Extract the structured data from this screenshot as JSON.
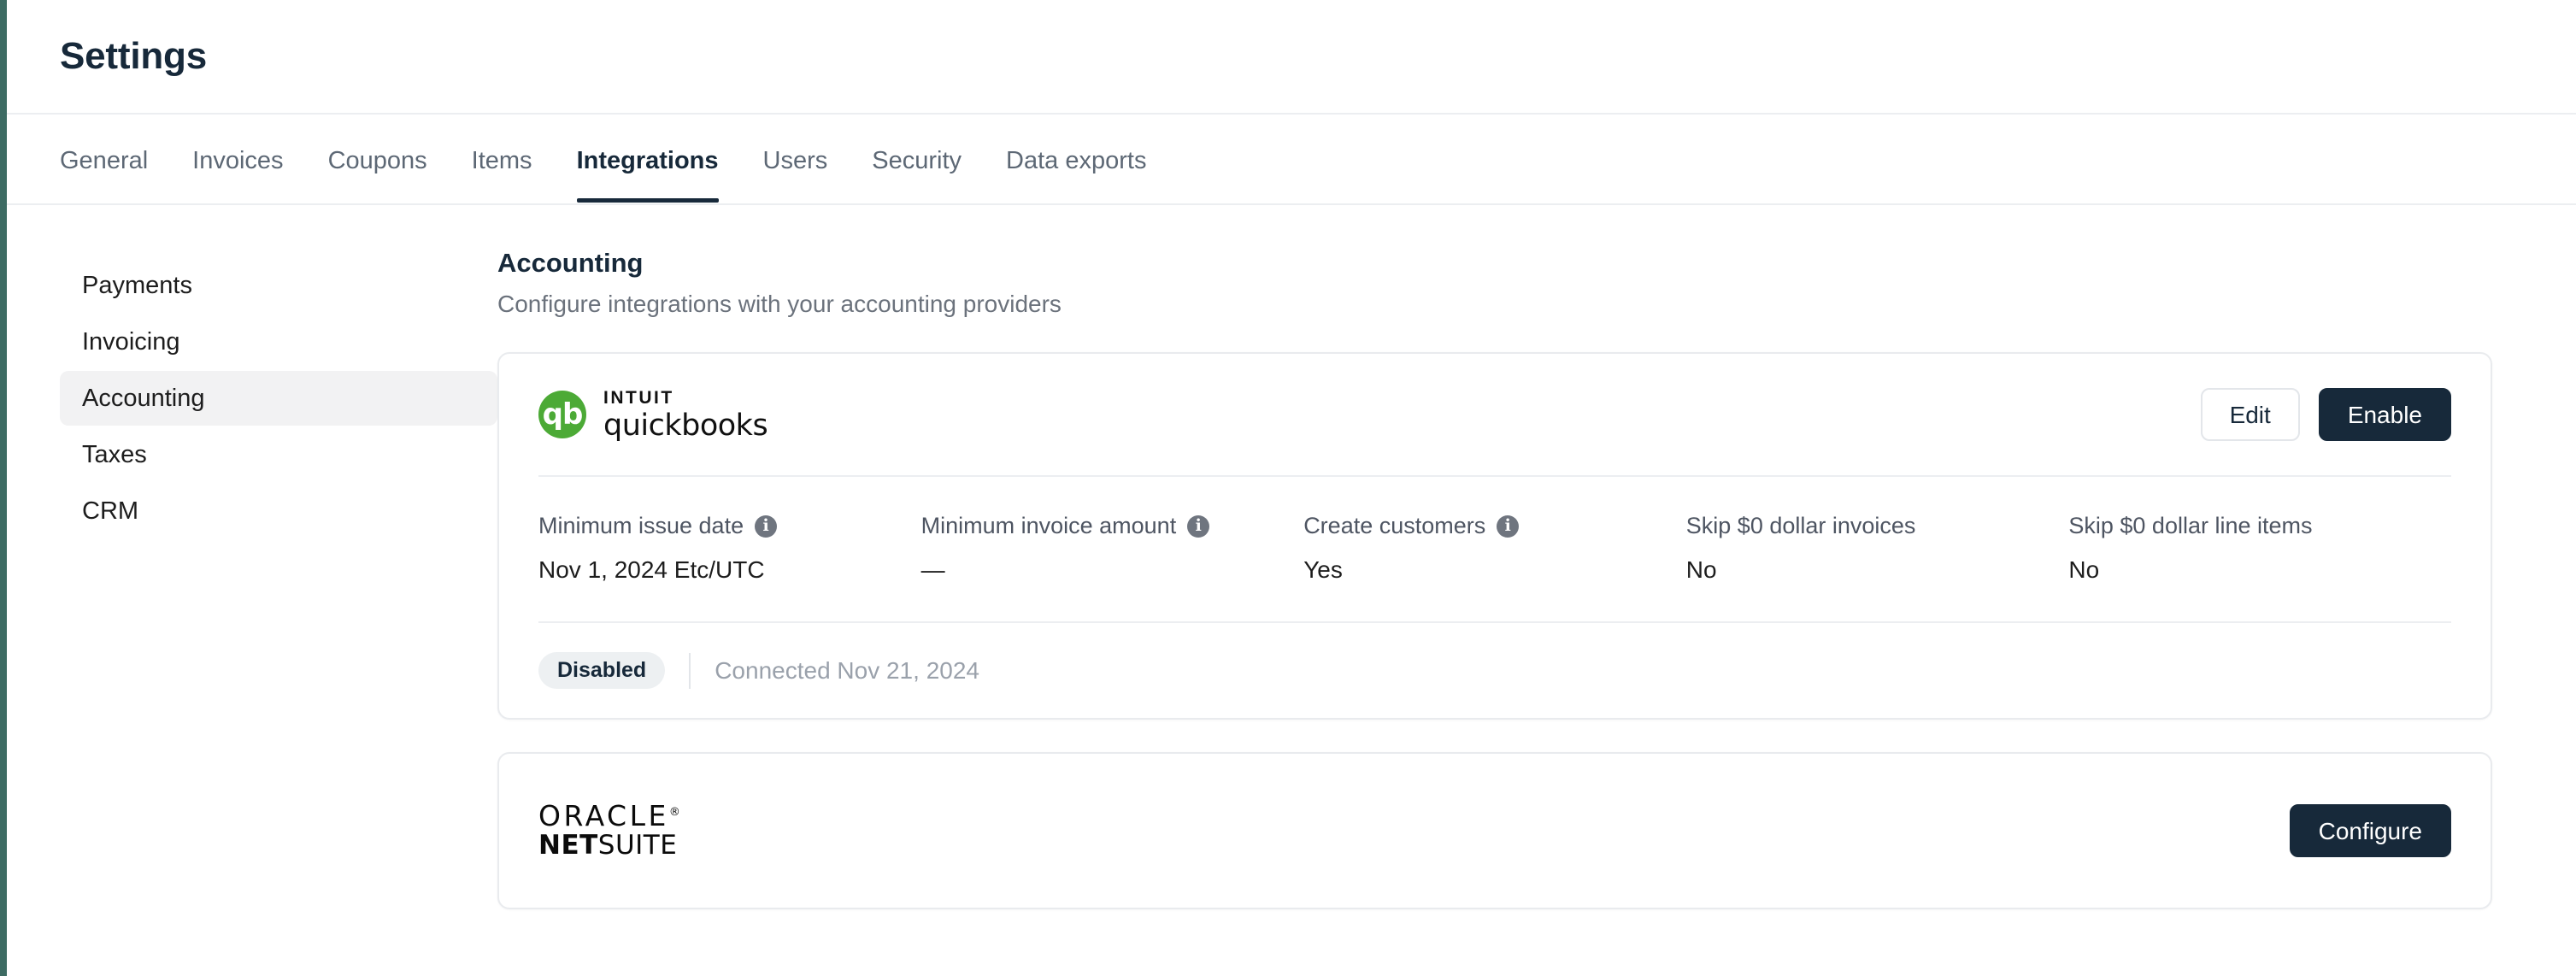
{
  "app": {
    "title": "Settings",
    "accent_stripe_color": "#3d6b63",
    "primary_color": "#17293a"
  },
  "tabs": [
    {
      "label": "General",
      "active": false
    },
    {
      "label": "Invoices",
      "active": false
    },
    {
      "label": "Coupons",
      "active": false
    },
    {
      "label": "Items",
      "active": false
    },
    {
      "label": "Integrations",
      "active": true
    },
    {
      "label": "Users",
      "active": false
    },
    {
      "label": "Security",
      "active": false
    },
    {
      "label": "Data exports",
      "active": false
    }
  ],
  "sidebar": {
    "items": [
      {
        "label": "Payments",
        "active": false
      },
      {
        "label": "Invoicing",
        "active": false
      },
      {
        "label": "Accounting",
        "active": true
      },
      {
        "label": "Taxes",
        "active": false
      },
      {
        "label": "CRM",
        "active": false
      }
    ]
  },
  "section": {
    "title": "Accounting",
    "subtitle": "Configure integrations with your accounting providers"
  },
  "quickbooks": {
    "logo": {
      "mark_text": "qb",
      "mark_color": "#4caa36",
      "brand_small": "INTUIT",
      "brand_main": "quickbooks"
    },
    "buttons": {
      "edit": "Edit",
      "enable": "Enable"
    },
    "details": [
      {
        "label": "Minimum issue date",
        "value": "Nov 1, 2024 Etc/UTC",
        "has_info": true
      },
      {
        "label": "Minimum invoice amount",
        "value": "—",
        "has_info": true
      },
      {
        "label": "Create customers",
        "value": "Yes",
        "has_info": true
      },
      {
        "label": "Skip $0 dollar invoices",
        "value": "No",
        "has_info": false
      },
      {
        "label": "Skip $0 dollar line items",
        "value": "No",
        "has_info": false
      }
    ],
    "status": "Disabled",
    "connected": "Connected Nov 21, 2024"
  },
  "netsuite": {
    "logo": {
      "line1": "ORACLE",
      "registered": "®",
      "line2_bold": "NET",
      "line2_rest": "SUITE"
    },
    "buttons": {
      "configure": "Configure"
    }
  }
}
